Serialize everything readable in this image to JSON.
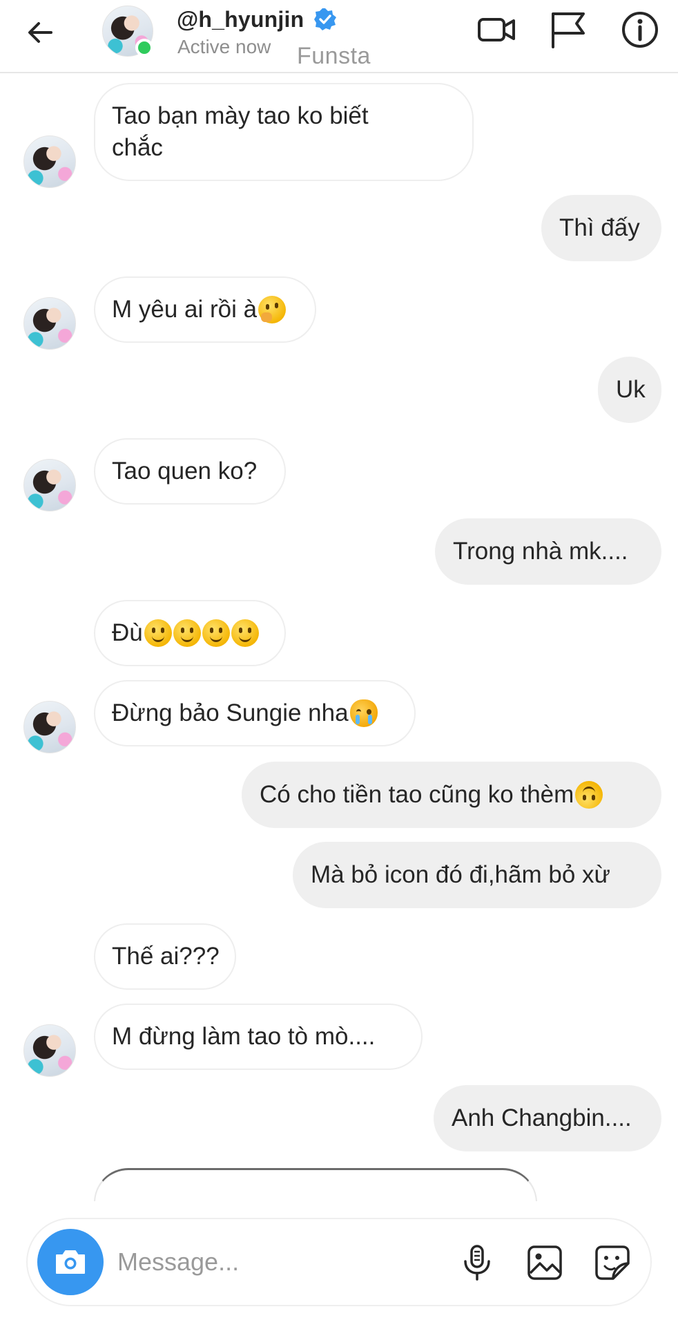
{
  "header": {
    "username": "@h_hyunjin",
    "status": "Active now",
    "label": "Funsta"
  },
  "messages": [
    {
      "side": "recv",
      "text": "Tao bạn mày tao ko biết chắc"
    },
    {
      "side": "sent",
      "text": "Thì đấy"
    },
    {
      "side": "recv",
      "text": "M yêu ai rồi à",
      "emoji": [
        "thinking-face"
      ]
    },
    {
      "side": "sent",
      "text": "Uk"
    },
    {
      "side": "recv",
      "text": "Tao quen ko?"
    },
    {
      "side": "sent",
      "text": "Trong nhà mk...."
    },
    {
      "side": "recv",
      "text": "Đù",
      "emoji": [
        "slightly-smiling-face",
        "slightly-smiling-face",
        "slightly-smiling-face",
        "slightly-smiling-face"
      ]
    },
    {
      "side": "recv",
      "text": "Đừng bảo Sungie nha",
      "emoji": [
        "crying-cat-face"
      ]
    },
    {
      "side": "sent",
      "text": "Có cho tiền tao cũng ko thèm",
      "emoji": [
        "upside-down-face"
      ]
    },
    {
      "side": "sent",
      "text": "Mà bỏ icon đó đi,hãm bỏ xừ"
    },
    {
      "side": "recv",
      "text": "Thế ai???"
    },
    {
      "side": "recv",
      "text": "M đừng làm tao tò mò...."
    },
    {
      "side": "sent",
      "text": "Anh Changbin...."
    }
  ],
  "composer": {
    "placeholder": "Message..."
  },
  "colors": {
    "accent": "#3797f0",
    "online": "#2fcb5c",
    "verified": "#3897f0",
    "sent_bubble": "#efefef",
    "recv_border": "#eeeeee"
  }
}
